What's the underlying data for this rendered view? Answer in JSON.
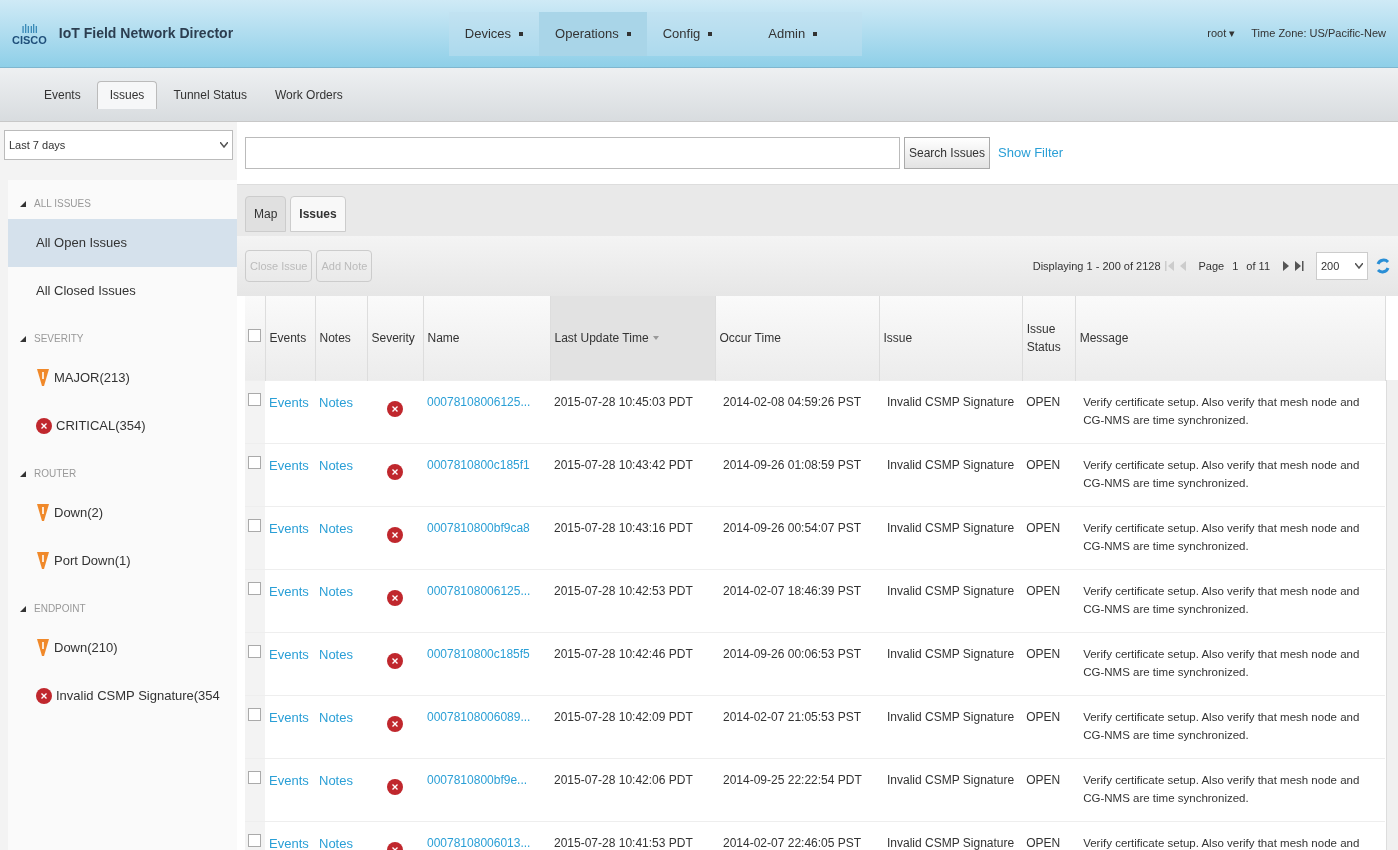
{
  "header": {
    "logo_mark": "ılıılı",
    "logo_word": "CISCO",
    "title": "IoT Field Network Director",
    "nav": [
      {
        "label": "Devices",
        "selected": false
      },
      {
        "label": "Operations",
        "selected": true
      },
      {
        "label": "Config",
        "selected": false
      },
      {
        "label": "Admin",
        "selected": false
      }
    ],
    "user": "root ▾",
    "timezone": "Time Zone: US/Pacific-New"
  },
  "subnav": [
    {
      "label": "Events",
      "selected": false
    },
    {
      "label": "Issues",
      "selected": true
    },
    {
      "label": "Tunnel Status",
      "selected": false
    },
    {
      "label": "Work Orders",
      "selected": false
    }
  ],
  "range_select": {
    "value": "Last 7 days"
  },
  "search": {
    "button": "Search Issues",
    "filter_link": "Show Filter"
  },
  "sidebar": [
    {
      "title": "ALL ISSUES",
      "expanded": true,
      "items": [
        {
          "label": "All Open Issues",
          "selected": true
        },
        {
          "label": "All Closed Issues",
          "selected": false
        }
      ]
    },
    {
      "title": "SEVERITY",
      "expanded": true,
      "items": [
        {
          "label": "MAJOR(213)",
          "kind": "major",
          "selected": false
        },
        {
          "label": "CRITICAL(354)",
          "kind": "critical",
          "selected": false
        }
      ]
    },
    {
      "title": "ROUTER",
      "expanded": true,
      "items": [
        {
          "label": "Down(2)",
          "kind": "major",
          "selected": false
        },
        {
          "label": "Port Down(1)",
          "kind": "major",
          "selected": false
        }
      ]
    },
    {
      "title": "ENDPOINT",
      "expanded": true,
      "items": [
        {
          "label": "Down(210)",
          "kind": "major",
          "selected": false
        },
        {
          "label": "Invalid CSMP Signature(354",
          "kind": "critical",
          "selected": false
        }
      ]
    }
  ],
  "view_tabs": [
    {
      "label": "Map",
      "selected": false
    },
    {
      "label": "Issues",
      "selected": true
    }
  ],
  "toolbar": {
    "buttons": [
      {
        "label": "Close Issue",
        "disabled": true
      },
      {
        "label": "Add Note",
        "disabled": true
      }
    ],
    "displaying": "Displaying 1 - 200 of 2128",
    "page_label": "Page",
    "page": "1",
    "page_of": "of 11",
    "page_size": "200"
  },
  "table": {
    "select_all_checked": false,
    "columns": [
      "Events",
      "Notes",
      "Severity",
      "Name",
      "Last Update Time",
      "Occur Time",
      "Issue",
      "Issue Status",
      "Message"
    ],
    "rows": [
      {
        "checked": false,
        "events": "Events",
        "notes": "Notes",
        "kind": "critical",
        "name": "00078108006125...",
        "last_update": "2015-07-28 10:45:03 PDT",
        "occur": "2014-02-08 04:59:26 PST",
        "issue": "Invalid CSMP Signature",
        "status": "OPEN",
        "message": "Verify certificate setup. Also verify that mesh node and CG-NMS are time synchronized."
      },
      {
        "checked": false,
        "events": "Events",
        "notes": "Notes",
        "kind": "critical",
        "name": "0007810800c185f1",
        "last_update": "2015-07-28 10:43:42 PDT",
        "occur": "2014-09-26 01:08:59 PST",
        "issue": "Invalid CSMP Signature",
        "status": "OPEN",
        "message": "Verify certificate setup. Also verify that mesh node and CG-NMS are time synchronized."
      },
      {
        "checked": false,
        "events": "Events",
        "notes": "Notes",
        "kind": "critical",
        "name": "0007810800bf9ca8",
        "last_update": "2015-07-28 10:43:16 PDT",
        "occur": "2014-09-26 00:54:07 PST",
        "issue": "Invalid CSMP Signature",
        "status": "OPEN",
        "message": "Verify certificate setup. Also verify that mesh node and CG-NMS are time synchronized."
      },
      {
        "checked": false,
        "events": "Events",
        "notes": "Notes",
        "kind": "critical",
        "name": "00078108006125...",
        "last_update": "2015-07-28 10:42:53 PDT",
        "occur": "2014-02-07 18:46:39 PST",
        "issue": "Invalid CSMP Signature",
        "status": "OPEN",
        "message": "Verify certificate setup. Also verify that mesh node and CG-NMS are time synchronized."
      },
      {
        "checked": false,
        "events": "Events",
        "notes": "Notes",
        "kind": "critical",
        "name": "0007810800c185f5",
        "last_update": "2015-07-28 10:42:46 PDT",
        "occur": "2014-09-26 00:06:53 PST",
        "issue": "Invalid CSMP Signature",
        "status": "OPEN",
        "message": "Verify certificate setup. Also verify that mesh node and CG-NMS are time synchronized."
      },
      {
        "checked": false,
        "events": "Events",
        "notes": "Notes",
        "kind": "critical",
        "name": "00078108006089...",
        "last_update": "2015-07-28 10:42:09 PDT",
        "occur": "2014-02-07 21:05:53 PST",
        "issue": "Invalid CSMP Signature",
        "status": "OPEN",
        "message": "Verify certificate setup. Also verify that mesh node and CG-NMS are time synchronized."
      },
      {
        "checked": false,
        "events": "Events",
        "notes": "Notes",
        "kind": "critical",
        "name": "0007810800bf9e...",
        "last_update": "2015-07-28 10:42:06 PDT",
        "occur": "2014-09-25 22:22:54 PDT",
        "issue": "Invalid CSMP Signature",
        "status": "OPEN",
        "message": "Verify certificate setup. Also verify that mesh node and CG-NMS are time synchronized."
      },
      {
        "checked": false,
        "events": "Events",
        "notes": "Notes",
        "kind": "critical",
        "name": "00078108006013...",
        "last_update": "2015-07-28 10:41:53 PDT",
        "occur": "2014-02-07 22:46:05 PST",
        "issue": "Invalid CSMP Signature",
        "status": "OPEN",
        "message": "Verify certificate setup. Also verify that mesh node and"
      }
    ]
  }
}
